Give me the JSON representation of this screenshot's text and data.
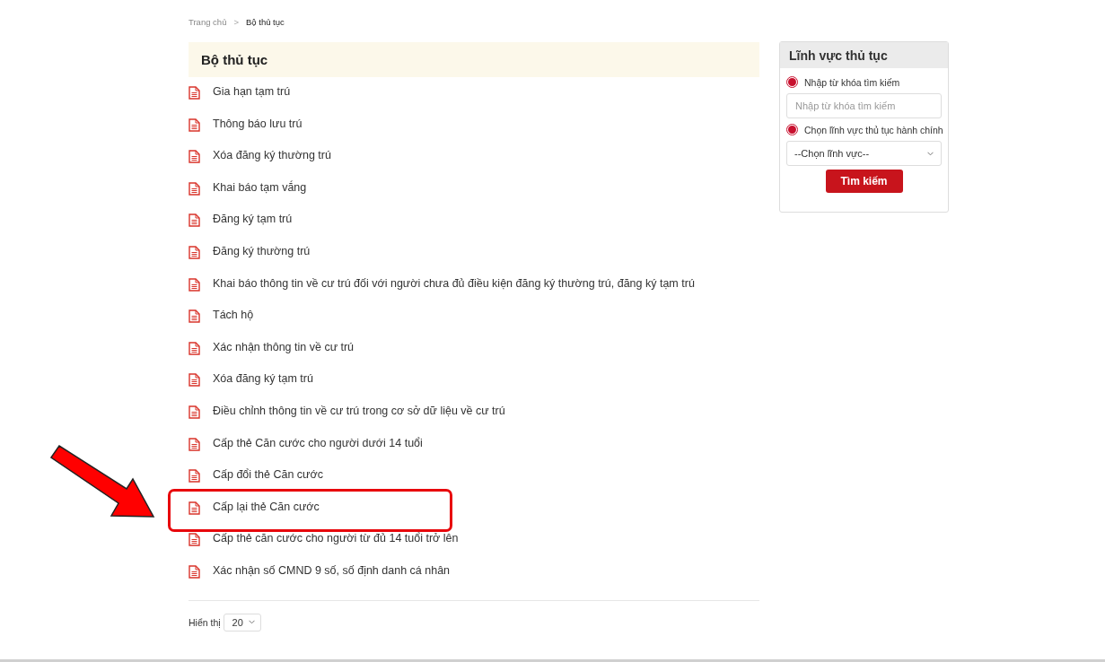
{
  "breadcrumb": [
    {
      "label": "Trang chủ",
      "current": false
    },
    {
      "label": "Bộ thủ tục",
      "current": true
    }
  ],
  "breadcrumb_separator": ">",
  "heading": "Bộ thủ tục",
  "procedures": [
    {
      "title": "Gia hạn tạm trú",
      "highlighted": false
    },
    {
      "title": "Thông báo lưu trú",
      "highlighted": false
    },
    {
      "title": "Xóa đăng ký thường trú",
      "highlighted": false
    },
    {
      "title": "Khai báo tạm vắng",
      "highlighted": false
    },
    {
      "title": "Đăng ký tạm trú",
      "highlighted": false
    },
    {
      "title": "Đăng ký thường trú",
      "highlighted": false
    },
    {
      "title": "Khai báo thông tin về cư trú đối với người chưa đủ điều kiện đăng ký thường trú, đăng ký tạm trú",
      "highlighted": false
    },
    {
      "title": "Tách hộ",
      "highlighted": false
    },
    {
      "title": "Xác nhận thông tin về cư trú",
      "highlighted": false
    },
    {
      "title": "Xóa đăng ký tạm trú",
      "highlighted": false
    },
    {
      "title": "Điều chỉnh thông tin về cư trú trong cơ sở dữ liệu về cư trú",
      "highlighted": false
    },
    {
      "title": "Cấp thẻ Căn cước cho người dưới 14 tuổi",
      "highlighted": false
    },
    {
      "title": "Cấp đổi thẻ Căn cước",
      "highlighted": false
    },
    {
      "title": "Cấp lại thẻ Căn cước",
      "highlighted": true
    },
    {
      "title": "Cấp thẻ căn cước cho người từ đủ 14 tuổi trở lên",
      "highlighted": false
    },
    {
      "title": "Xác nhận số CMND 9 số, số định danh cá nhân",
      "highlighted": false
    }
  ],
  "page_size": {
    "label": "Hiển thị",
    "value": "20"
  },
  "sidebar": {
    "title": "Lĩnh vực thủ tục",
    "keyword_option": {
      "label": "Nhập từ khóa tìm kiếm",
      "checked": true
    },
    "keyword_field": {
      "placeholder": "Nhập từ khóa tìm kiếm"
    },
    "field_option": {
      "label": "Chọn lĩnh vực thủ tục hành chính",
      "checked": true
    },
    "field_select": {
      "value": "--Chọn lĩnh vực--"
    },
    "search_button": "Tìm kiếm"
  }
}
